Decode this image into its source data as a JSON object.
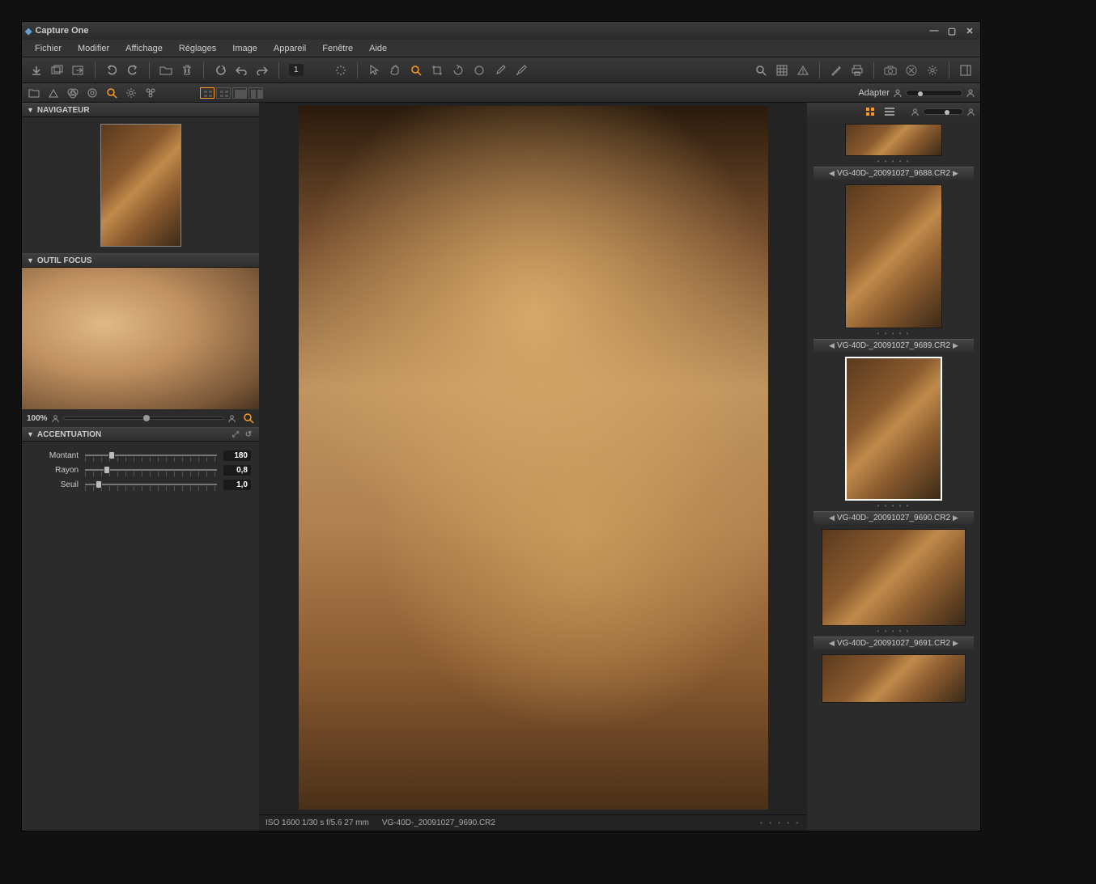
{
  "app": {
    "title": "Capture One"
  },
  "menu": [
    "Fichier",
    "Modifier",
    "Affichage",
    "Réglages",
    "Image",
    "Appareil",
    "Fenêtre",
    "Aide"
  ],
  "toolbar": {
    "badge": "1",
    "adapter_label": "Adapter"
  },
  "panels": {
    "navigator": {
      "title": "NAVIGATEUR"
    },
    "focus": {
      "title": "OUTIL FOCUS",
      "zoom_label": "100%"
    },
    "accent": {
      "title": "ACCENTUATION",
      "rows": [
        {
          "label": "Montant",
          "value": "180",
          "pos": 18
        },
        {
          "label": "Rayon",
          "value": "0,8",
          "pos": 14
        },
        {
          "label": "Seuil",
          "value": "1,0",
          "pos": 8
        }
      ]
    }
  },
  "viewer": {
    "status_left": "ISO 1600   1/30 s   f/5.6   27 mm",
    "status_file": "VG-40D-_20091027_9690.CR2"
  },
  "browser": {
    "items": [
      {
        "name": "VG-40D-_20091027_9688.CR2",
        "landscape": false,
        "selected": false,
        "partial": true
      },
      {
        "name": "VG-40D-_20091027_9689.CR2",
        "landscape": false,
        "selected": true
      },
      {
        "name": "VG-40D-_20091027_9690.CR2",
        "landscape": false,
        "selected": false
      },
      {
        "name": "VG-40D-_20091027_9691.CR2",
        "landscape": true,
        "selected": false
      }
    ]
  }
}
